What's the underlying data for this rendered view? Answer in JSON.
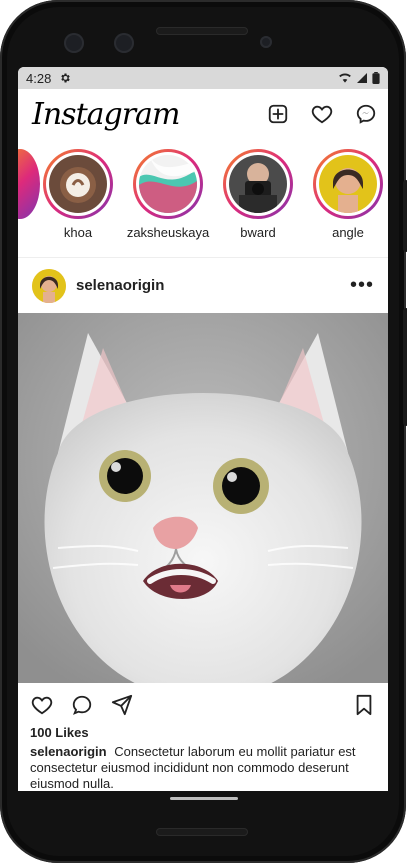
{
  "status": {
    "time": "4:28",
    "icons": [
      "settings-icon",
      "wifi-icon",
      "signal-icon",
      "battery-icon"
    ]
  },
  "app": {
    "logo_text": "Instagram",
    "top_icons": [
      "add-post-icon",
      "heart-icon",
      "messenger-icon"
    ]
  },
  "stories": [
    {
      "label": "khoa",
      "avatar": "coffee-avatar"
    },
    {
      "label": "zaksheuskaya",
      "avatar": "paint-avatar"
    },
    {
      "label": "bward",
      "avatar": "camera-avatar"
    },
    {
      "label": "angle",
      "avatar": "person-avatar"
    }
  ],
  "post": {
    "username": "selenaorigin",
    "likes": "100 Likes",
    "caption_user": "selenaorigin",
    "caption_text": "Consectetur laborum eu mollit pariatur est consectetur eiusmod incididunt non commodo deserunt eiusmod nulla.",
    "image": "cat-photo"
  },
  "colors": {
    "story_ring_start": "#f58529",
    "story_ring_end": "#dd2a7b",
    "status_bar": "#d9d9d9",
    "phone_frame": "#0b0b0b"
  }
}
